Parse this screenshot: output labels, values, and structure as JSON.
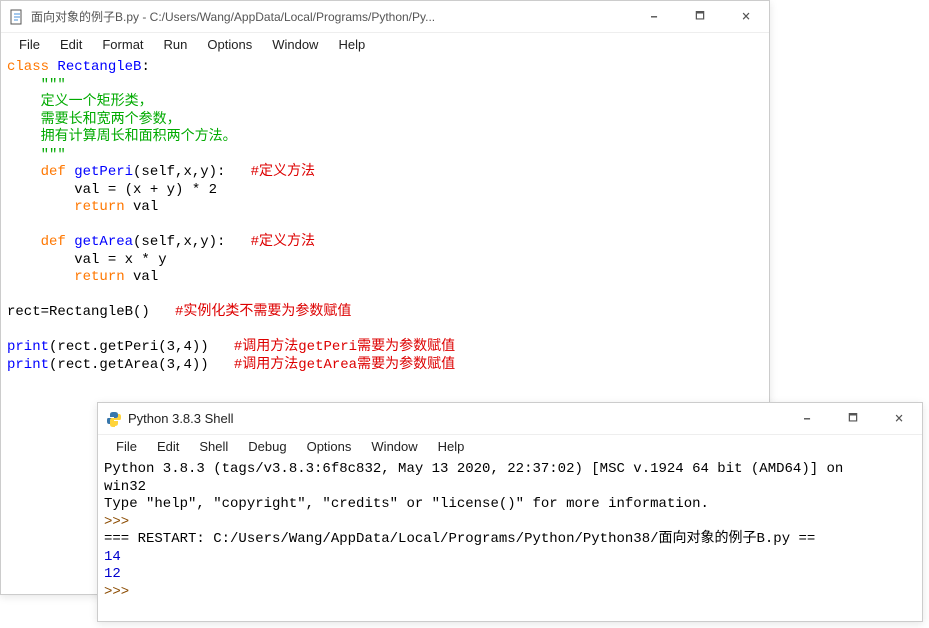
{
  "editor": {
    "title": "面向对象的例子B.py - C:/Users/Wang/AppData/Local/Programs/Python/Py...",
    "menus": [
      "File",
      "Edit",
      "Format",
      "Run",
      "Options",
      "Window",
      "Help"
    ],
    "code": {
      "l1_kw": "class",
      "l1_cls": " RectangleB",
      "l1_colon": ":",
      "l2_str": "    \"\"\"",
      "l3_str": "    定义一个矩形类，",
      "l4_str": "    需要长和宽两个参数，",
      "l5_str": "    拥有计算周长和面积两个方法。",
      "l6_str": "    \"\"\"",
      "l7_def": "    def",
      "l7_fn": " getPeri",
      "l7_args": "(self,x,y):   ",
      "l7_cmt": "#定义方法",
      "l8": "        val = (x + y) * 2",
      "l9_ret": "        return",
      "l9_val": " val",
      "l11_def": "    def",
      "l11_fn": " getArea",
      "l11_args": "(self,x,y):   ",
      "l11_cmt": "#定义方法",
      "l12": "        val = x * y",
      "l13_ret": "        return",
      "l13_val": " val",
      "l15_a": "rect=RectangleB()   ",
      "l15_cmt": "#实例化类不需要为参数赋值",
      "l17_p": "print",
      "l17_a": "(rect.getPeri(3,4))   ",
      "l17_cmt": "#调用方法getPeri需要为参数赋值",
      "l18_p": "print",
      "l18_a": "(rect.getArea(3,4))   ",
      "l18_cmt": "#调用方法getArea需要为参数赋值"
    }
  },
  "shell": {
    "title": "Python 3.8.3 Shell",
    "menus": [
      "File",
      "Edit",
      "Shell",
      "Debug",
      "Options",
      "Window",
      "Help"
    ],
    "out": {
      "banner1": "Python 3.8.3 (tags/v3.8.3:6f8c832, May 13 2020, 22:37:02) [MSC v.1924 64 bit (AMD64)] on",
      "banner2": "win32",
      "banner3": "Type \"help\", \"copyright\", \"credits\" or \"license()\" for more information.",
      "prompt1": ">>> ",
      "restart": "=== RESTART: C:/Users/Wang/AppData/Local/Programs/Python/Python38/面向对象的例子B.py ==",
      "r1": "14",
      "r2": "12",
      "prompt2": ">>> "
    }
  },
  "controls": {
    "min": "🗕",
    "max": "🗖",
    "close": "🗙"
  }
}
